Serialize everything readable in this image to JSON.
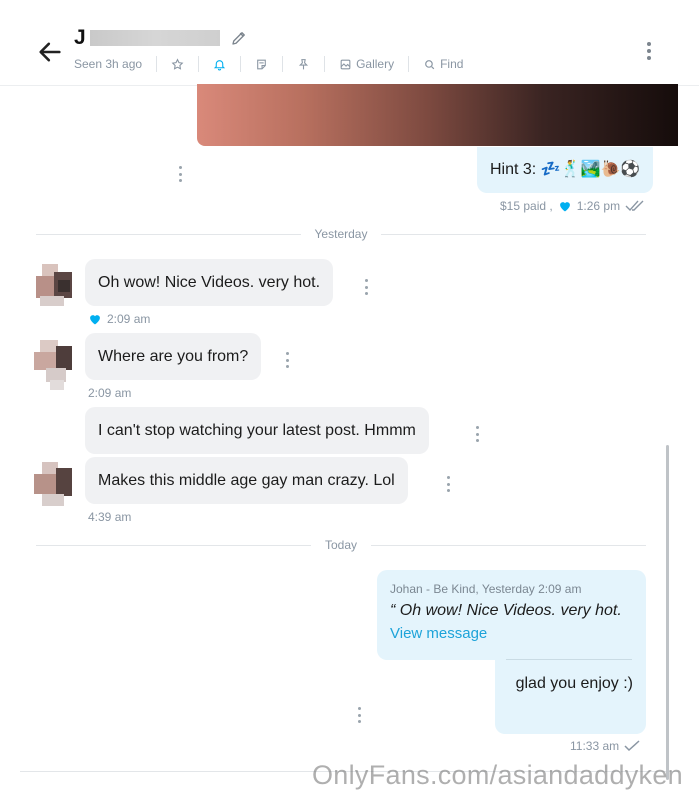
{
  "header": {
    "name_initial": "J",
    "status": "Seen 3h ago",
    "gallery_label": "Gallery",
    "find_label": "Find"
  },
  "messages": {
    "hint": "Hint 3: 💤🕺🏞️🐌⚽",
    "hint_meta_paid": "$15 paid ,",
    "hint_meta_time": "1:26 pm",
    "day_yesterday": "Yesterday",
    "m1_text": "Oh wow! Nice Videos. very hot.",
    "m1_time": "2:09 am",
    "m2_text": "Where are you from?",
    "m2_time": "2:09 am",
    "m3_text": "I can't stop watching your latest post. Hmmm",
    "m4_text": "Makes this middle age gay man crazy. Lol",
    "m4_time": "4:39 am",
    "day_today": "Today",
    "quote_meta": "Johan - Be Kind, Yesterday 2:09 am",
    "quote_text": "“ Oh wow! Nice Videos. very hot.",
    "quote_link": "View message",
    "reply_text": "glad you enjoy :)",
    "reply_time": "11:33 am"
  },
  "watermark": "OnlyFans.com/asiandaddyken",
  "colors": {
    "accent": "#00aff0",
    "out_bubble": "#e4f4fc",
    "in_bubble": "#f0f1f3",
    "muted": "#8a96a3"
  },
  "icons": {
    "back": "arrow-left-icon",
    "edit": "pencil-icon",
    "star": "star-icon",
    "bell": "bell-icon",
    "note": "note-icon",
    "pin": "pin-icon",
    "gallery": "image-icon",
    "find": "search-icon",
    "menu": "more-vertical-icon"
  }
}
